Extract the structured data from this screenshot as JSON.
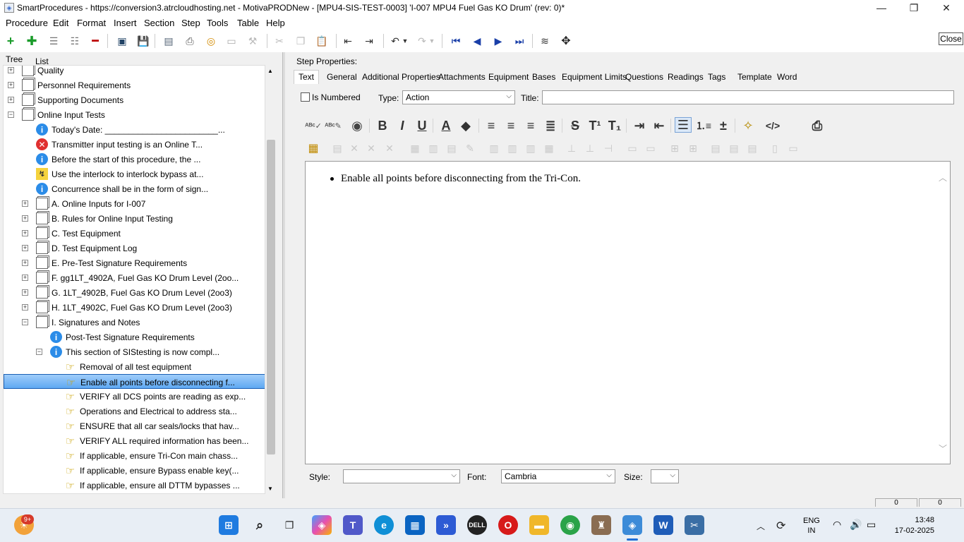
{
  "window": {
    "title": "SmartProcedures - https://conversion3.atrcloudhosting.net - MotivaPRODNew - [MPU4-SIS-TEST-0003] 'I-007 MPU4 Fuel Gas KO Drum' (rev: 0)*",
    "minimize": "—",
    "maximize": "❐",
    "close": "✕"
  },
  "menu": [
    "Procedure",
    "Edit",
    "Format",
    "Insert",
    "Section",
    "Step",
    "Tools",
    "Table",
    "Help"
  ],
  "tooltip": "Close",
  "left_tabs": [
    "Tree",
    "List"
  ],
  "tree": [
    {
      "label": "Quality",
      "icon": "doc",
      "level": 1,
      "expander": "+"
    },
    {
      "label": "Personnel Requirements",
      "icon": "doc",
      "level": 1,
      "expander": "+"
    },
    {
      "label": "Supporting Documents",
      "icon": "doc",
      "level": 1,
      "expander": "+"
    },
    {
      "label": "Online Input Tests",
      "icon": "doc",
      "level": 1,
      "expander": "−"
    },
    {
      "label": "Today's Date: ________________________...",
      "icon": "info",
      "level": 2,
      "expander": ""
    },
    {
      "label": "Transmitter input testing is an Online T...",
      "icon": "error",
      "level": 2,
      "expander": ""
    },
    {
      "label": "Before the start of this procedure, the ...",
      "icon": "info",
      "level": 2,
      "expander": ""
    },
    {
      "label": "Use the interlock to interlock bypass at...",
      "icon": "warn",
      "level": 2,
      "expander": ""
    },
    {
      "label": "Concurrence shall be in the form of sign...",
      "icon": "info",
      "level": 2,
      "expander": ""
    },
    {
      "label": "A. Online Inputs for I-007",
      "icon": "doc",
      "level": 2,
      "expander": "+"
    },
    {
      "label": "B. Rules for Online Input Testing",
      "icon": "doc",
      "level": 2,
      "expander": "+"
    },
    {
      "label": "C. Test Equipment",
      "icon": "doc",
      "level": 2,
      "expander": "+"
    },
    {
      "label": "D. Test Equipment Log",
      "icon": "doc",
      "level": 2,
      "expander": "+"
    },
    {
      "label": "E. Pre-Test Signature Requirements",
      "icon": "doc",
      "level": 2,
      "expander": "+"
    },
    {
      "label": "F. gg1LT_4902A, Fuel Gas KO Drum Level (2oo...",
      "icon": "doc",
      "level": 2,
      "expander": "+"
    },
    {
      "label": "G. 1LT_4902B, Fuel Gas KO Drum Level (2oo3)",
      "icon": "doc",
      "level": 2,
      "expander": "+"
    },
    {
      "label": "H. 1LT_4902C, Fuel Gas KO Drum Level (2oo3)",
      "icon": "doc",
      "level": 2,
      "expander": "+"
    },
    {
      "label": "I. Signatures and Notes",
      "icon": "doc",
      "level": 2,
      "expander": "−"
    },
    {
      "label": "Post-Test Signature Requirements",
      "icon": "info",
      "level": 3,
      "expander": ""
    },
    {
      "label": "This section of SIStesting is now compl...",
      "icon": "info",
      "level": 3,
      "expander": "−"
    },
    {
      "label": "Removal of all test equipment",
      "icon": "hand",
      "level": 4,
      "expander": ""
    },
    {
      "label": "Enable all points before disconnecting f...",
      "icon": "hand",
      "level": 4,
      "expander": "",
      "selected": true
    },
    {
      "label": "VERIFY all DCS points are reading as exp...",
      "icon": "hand",
      "level": 4,
      "expander": ""
    },
    {
      "label": "Operations and Electrical to address sta...",
      "icon": "hand",
      "level": 4,
      "expander": ""
    },
    {
      "label": "ENSURE that all car seals/locks that hav...",
      "icon": "hand",
      "level": 4,
      "expander": ""
    },
    {
      "label": "VERIFY ALL required information has been...",
      "icon": "hand",
      "level": 4,
      "expander": ""
    },
    {
      "label": "If applicable, ensure Tri-Con main chass...",
      "icon": "hand",
      "level": 4,
      "expander": ""
    },
    {
      "label": "If applicable, ensure Bypass enable key(...",
      "icon": "hand",
      "level": 4,
      "expander": ""
    },
    {
      "label": "If applicable, ensure all DTTM bypasses ...",
      "icon": "hand",
      "level": 4,
      "expander": ""
    }
  ],
  "step": {
    "header": "Step Properties:",
    "tabs": [
      "Text",
      "General",
      "Additional Properties",
      "Attachments",
      "Equipment",
      "Bases",
      "Equipment Limits",
      "Questions",
      "Readings",
      "Tags",
      "Template",
      "Word"
    ],
    "is_numbered_label": "Is Numbered",
    "is_numbered": false,
    "type_label": "Type:",
    "type_value": "Action",
    "title_label": "Title:",
    "title_value": "",
    "content": "Enable all points before disconnecting from the Tri-Con.",
    "style_label": "Style:",
    "style_value": "",
    "font_label": "Font:",
    "font_value": "Cambria",
    "size_label": "Size:",
    "size_value": ""
  },
  "statusbar": [
    "0",
    "0"
  ],
  "taskbar": {
    "notification_badge": "9+",
    "lang_line1": "ENG",
    "lang_line2": "IN",
    "time": "13:48",
    "date": "17-02-2025"
  },
  "colors": {
    "selection": "#5ea8f2",
    "info": "#2b8ce8",
    "error": "#e03030",
    "accent": "#1a5fb4"
  }
}
